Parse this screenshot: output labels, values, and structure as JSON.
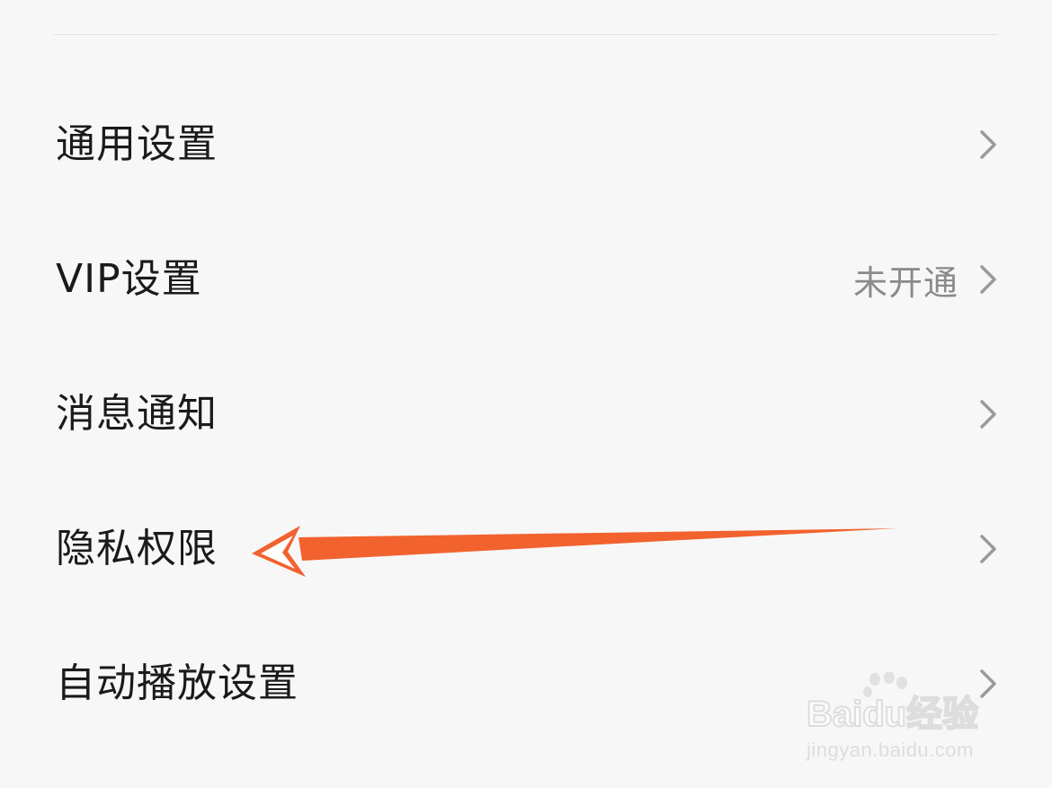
{
  "settings": {
    "items": [
      {
        "label": "通用设置",
        "value": ""
      },
      {
        "label": "VIP设置",
        "value": "未开通"
      },
      {
        "label": "消息通知",
        "value": ""
      },
      {
        "label": "隐私权限",
        "value": ""
      },
      {
        "label": "自动播放设置",
        "value": ""
      }
    ]
  },
  "annotation": {
    "arrow_color": "#f2622e",
    "points_to": "隐私权限"
  },
  "watermark": {
    "logo_text": "Baidu经验",
    "sub_text": "jingyan.baidu.com"
  },
  "icons": {
    "row_chevron": "chevron-right-icon"
  },
  "colors": {
    "background": "#f7f7f7",
    "label": "#1a1a1a",
    "value": "#8a8a8a",
    "chevron": "#9a9a9a",
    "divider": "#e3e3e3"
  }
}
